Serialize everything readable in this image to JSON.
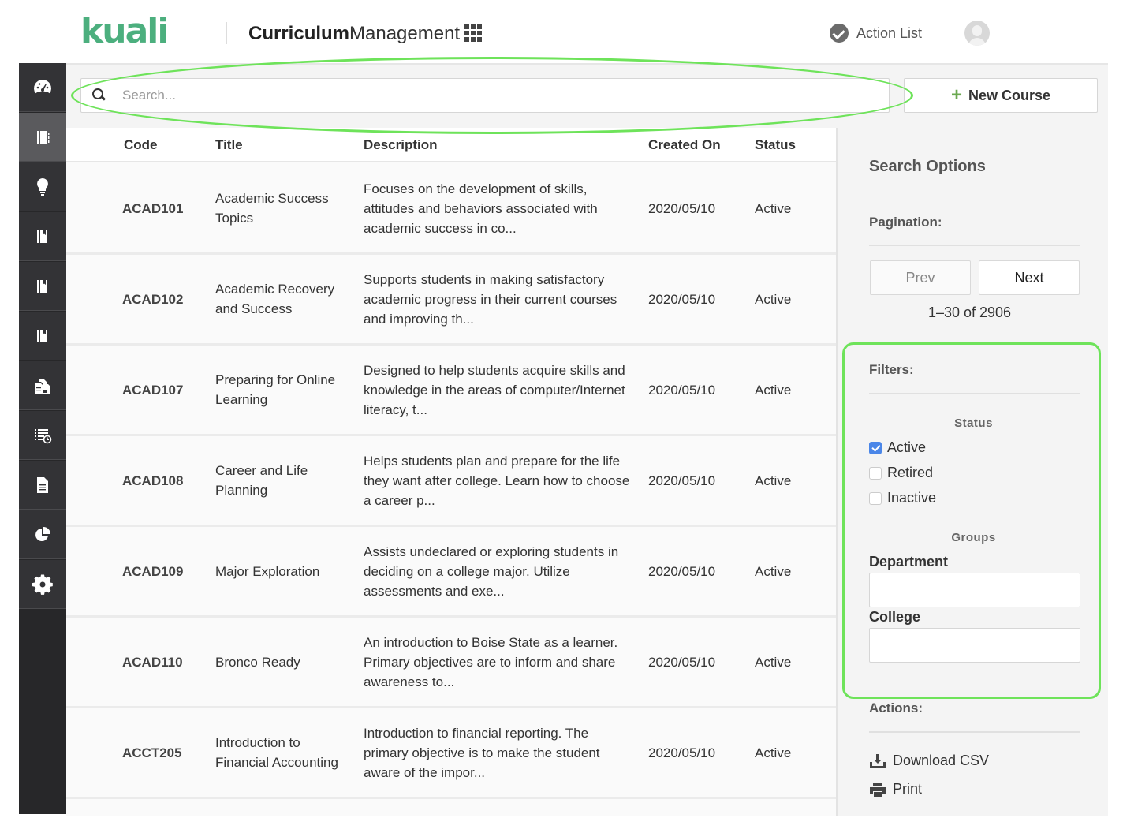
{
  "header": {
    "logo": "kuali",
    "app_title_bold": "Curriculum",
    "app_title_light": "Management",
    "action_list_label": "Action List"
  },
  "sidebar": {
    "items": [
      {
        "icon": "dashboard-gauge-icon",
        "active": false
      },
      {
        "icon": "courses-book-icon",
        "active": true
      },
      {
        "icon": "lightbulb-icon",
        "active": false
      },
      {
        "icon": "programs-book-icon",
        "active": false
      },
      {
        "icon": "specializations-book-icon",
        "active": false
      },
      {
        "icon": "experiences-book-icon",
        "active": false
      },
      {
        "icon": "documents-stack-icon",
        "active": false
      },
      {
        "icon": "list-clock-icon",
        "active": false
      },
      {
        "icon": "document-icon",
        "active": false
      },
      {
        "icon": "pie-chart-icon",
        "active": false
      },
      {
        "icon": "gear-icon",
        "active": false
      }
    ]
  },
  "search": {
    "placeholder": "Search...",
    "value": ""
  },
  "toolbar": {
    "new_course_label": "New Course"
  },
  "table": {
    "columns": [
      "Code",
      "Title",
      "Description",
      "Created On",
      "Status"
    ],
    "rows": [
      {
        "code": "ACAD101",
        "title": "Academic Success Topics",
        "description": "Focuses on the development of skills, attitudes and behaviors associated with academic success in co...",
        "created_on": "2020/05/10",
        "status": "Active"
      },
      {
        "code": "ACAD102",
        "title": "Academic Recovery and Success",
        "description": "Supports students in making satisfactory academic progress in their current courses and improving th...",
        "created_on": "2020/05/10",
        "status": "Active"
      },
      {
        "code": "ACAD107",
        "title": "Preparing for Online Learning",
        "description": "Designed to help students acquire skills and knowledge in the areas of computer/Internet literacy, t...",
        "created_on": "2020/05/10",
        "status": "Active"
      },
      {
        "code": "ACAD108",
        "title": "Career and Life Planning",
        "description": "Helps students plan and prepare for the life they want after college. Learn how to choose a career p...",
        "created_on": "2020/05/10",
        "status": "Active"
      },
      {
        "code": "ACAD109",
        "title": "Major Exploration",
        "description": "Assists undeclared or exploring students in deciding on a college major. Utilize assessments and exe...",
        "created_on": "2020/05/10",
        "status": "Active"
      },
      {
        "code": "ACAD110",
        "title": "Bronco Ready",
        "description": "An introduction to Boise State as a learner. Primary objectives are to inform and share awareness to...",
        "created_on": "2020/05/10",
        "status": "Active"
      },
      {
        "code": "ACCT205",
        "title": "Introduction to Financial Accounting",
        "description": "Introduction to financial reporting. The primary objective is to make the student aware of the impor...",
        "created_on": "2020/05/10",
        "status": "Active"
      }
    ]
  },
  "panel": {
    "title": "Search Options",
    "pagination_label": "Pagination:",
    "prev_label": "Prev",
    "next_label": "Next",
    "range_text": "1–30 of 2906",
    "filters_label": "Filters:",
    "status_group_label": "Status",
    "status_options": [
      {
        "label": "Active",
        "checked": true
      },
      {
        "label": "Retired",
        "checked": false
      },
      {
        "label": "Inactive",
        "checked": false
      }
    ],
    "groups_label": "Groups",
    "department_label": "Department",
    "department_value": "",
    "college_label": "College",
    "college_value": "",
    "actions_label": "Actions:",
    "download_csv_label": "Download CSV",
    "print_label": "Print"
  },
  "colors": {
    "brand_green": "#4caf7e",
    "sidebar_bg": "#272729",
    "sidebar_active": "#5a5a5d",
    "checkbox_blue": "#4a86e8",
    "annotation_green": "#6ee35a"
  }
}
